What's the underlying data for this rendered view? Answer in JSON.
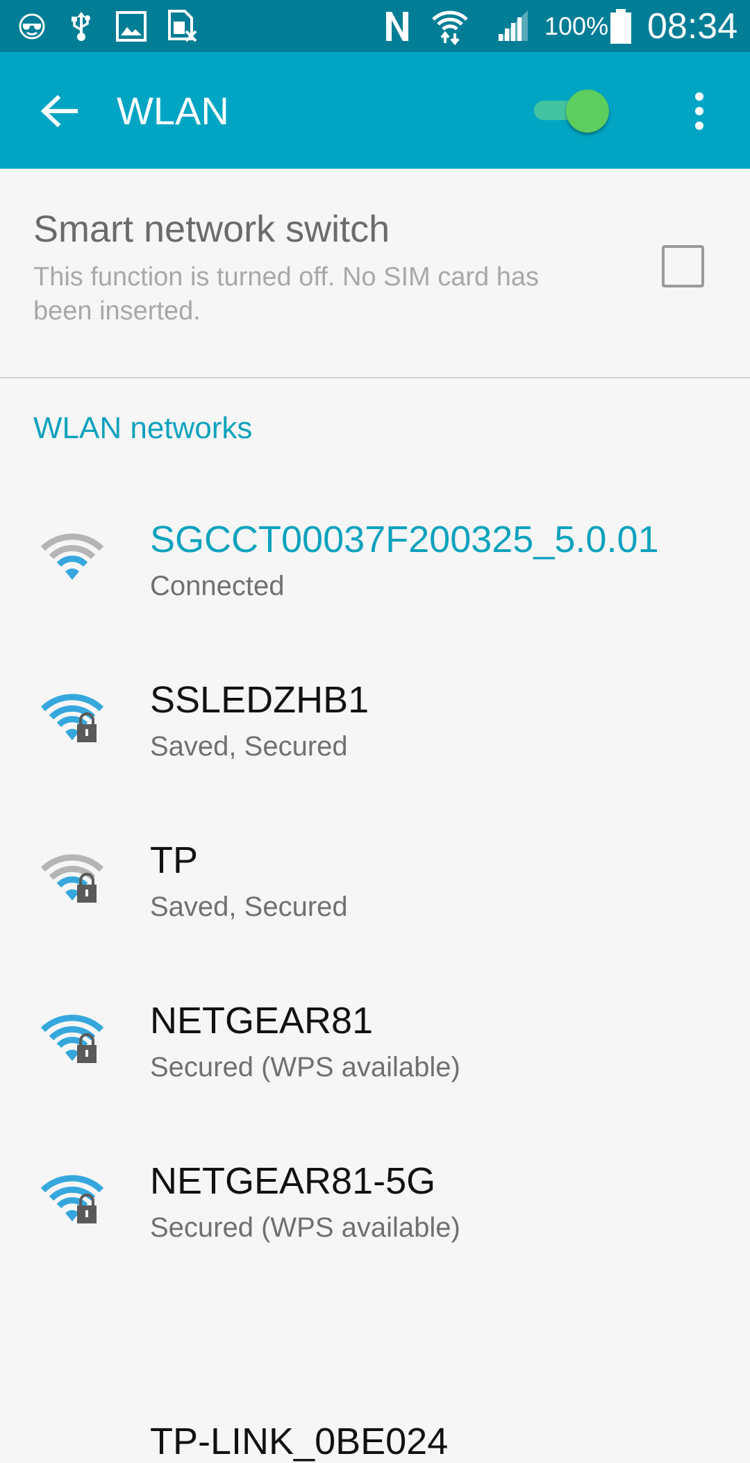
{
  "status_bar": {
    "left_icons": [
      "sunglasses-icon",
      "usb-icon",
      "gallery-icon",
      "sim-off-icon"
    ],
    "right_icons": [
      "nfc-icon",
      "wifi-transfer-icon",
      "cell-signal-icon",
      "battery-icon"
    ],
    "battery_percent": "100%",
    "time": "08:34"
  },
  "app_bar": {
    "title": "WLAN",
    "wlan_enabled": true
  },
  "smart_switch": {
    "title": "Smart network switch",
    "description": "This function is turned off. No SIM card has been inserted.",
    "checked": false
  },
  "networks_header": "WLAN networks",
  "networks": [
    {
      "name": "SGCCT00037F200325_5.0.01",
      "status": "Connected",
      "connected": true,
      "secured": false,
      "signal_bars": 2
    },
    {
      "name": "SSLEDZHB1",
      "status": "Saved, Secured",
      "connected": false,
      "secured": true,
      "signal_bars": 4
    },
    {
      "name": "TP",
      "status": "Saved, Secured",
      "connected": false,
      "secured": true,
      "signal_bars": 2
    },
    {
      "name": "NETGEAR81",
      "status": "Secured (WPS available)",
      "connected": false,
      "secured": true,
      "signal_bars": 4
    },
    {
      "name": "NETGEAR81-5G",
      "status": "Secured (WPS available)",
      "connected": false,
      "secured": true,
      "signal_bars": 4
    },
    {
      "name": "TP-LINK_0BE024",
      "status": "",
      "connected": false,
      "secured": true,
      "signal_bars": 4
    }
  ],
  "colors": {
    "status_bar": "#017d96",
    "app_bar": "#01a5c4",
    "accent": "#0ea2bd",
    "toggle_thumb": "#5ccd5e",
    "wifi_active": "#36a7dd",
    "wifi_inactive": "#b5b5b5"
  }
}
